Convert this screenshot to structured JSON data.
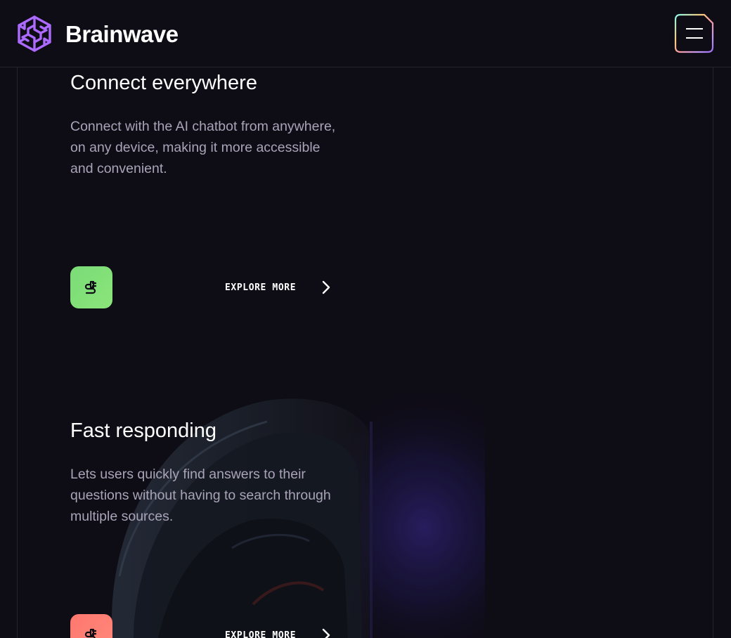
{
  "header": {
    "brand": "Brainwave",
    "logo_icon": "brain-icon",
    "menu_icon": "hamburger-menu-icon"
  },
  "colors": {
    "background": "#0e0c15",
    "logo": "#ac6aff",
    "icon_green": "#7adb78",
    "icon_red": "#ff776f"
  },
  "cards": [
    {
      "title": "Connect everywhere",
      "text": "Connect with the AI chatbot from anywhere, on any device, making it more accessible and convenient.",
      "icon": "plug-icon",
      "cta": "EXPLORE MORE"
    },
    {
      "title": "Fast responding",
      "text": "Lets users quickly find answers to their questions without having to search through multiple sources.",
      "icon": "plug-icon",
      "cta": "EXPLORE MORE"
    }
  ]
}
